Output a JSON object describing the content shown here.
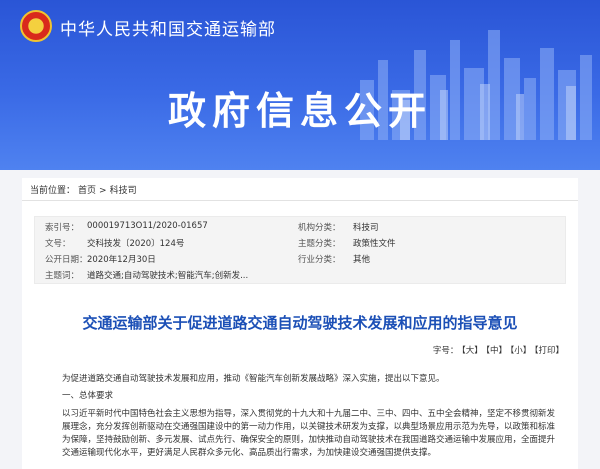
{
  "header": {
    "ministry_name": "中华人民共和国交通运输部",
    "hero_title": "政府信息公开"
  },
  "breadcrumb": {
    "prefix": "当前位置：",
    "items": [
      "首页",
      ">",
      "科技司"
    ]
  },
  "meta": {
    "rows": [
      {
        "label": "索引号：",
        "value": "000019713O11/2020-01657",
        "label2": "机构分类：",
        "value2": "科技司"
      },
      {
        "label": "文号：",
        "value": "交科技发〔2020〕124号",
        "label2": "主题分类：",
        "value2": "政策性文件"
      },
      {
        "label": "公开日期：",
        "value": "2020年12月30日",
        "label2": "行业分类：",
        "value2": "其他"
      },
      {
        "label": "主题词：",
        "value": "道路交通;自动驾驶技术;智能汽车;创新发...",
        "label2": "",
        "value2": ""
      }
    ]
  },
  "document": {
    "title": "交通运输部关于促进道路交通自动驾驶技术发展和应用的指导意见",
    "font_controls": {
      "label": "字号：",
      "large": "【大】",
      "medium": "【中】",
      "small": "【小】",
      "print": "【打印】"
    },
    "paragraphs": [
      "为促进道路交通自动驾驶技术发展和应用，推动《智能汽车创新发展战略》深入实施，提出以下意见。",
      "一、总体要求",
      "以习近平新时代中国特色社会主义思想为指导，深入贯彻党的十九大和十九届二中、三中、四中、五中全会精神，坚定不移贯彻新发展理念，充分发挥创新驱动在交通强国建设中的第一动力作用，以关键技术研发为支撑，以典型场景应用示范为先导，以政策和标准为保障，坚持鼓励创新、多元发展、试点先行、确保安全的原则，加快推动自动驾驶技术在我国道路交通运输中发展应用，全面提升交通运输现代化水平，更好满足人民群众多元化、高品质出行需求，为加快建设交通强国提供支撑。"
    ]
  },
  "colors": {
    "banner": "#3a6ae6",
    "title_blue": "#1b4fb6",
    "background": "#f3f4f8"
  }
}
